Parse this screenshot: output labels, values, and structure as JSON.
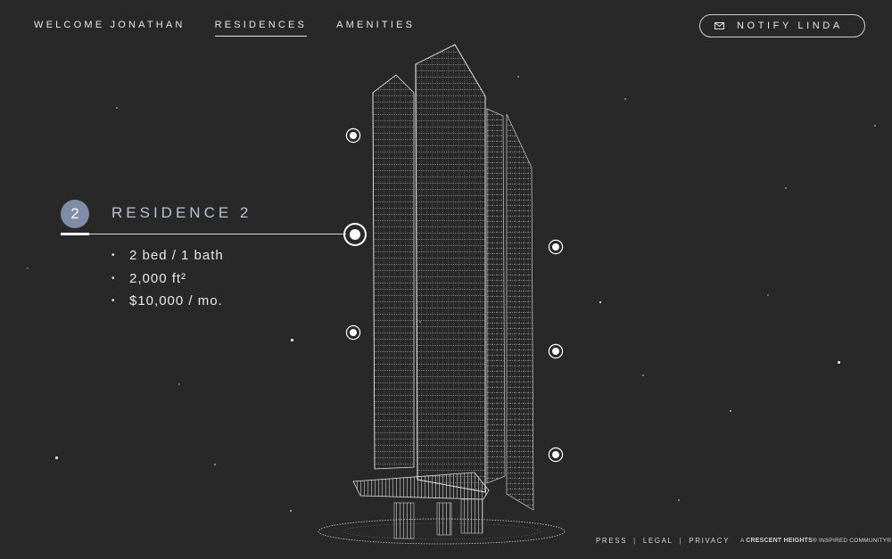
{
  "nav": {
    "items": [
      {
        "label": "WELCOME JONATHAN",
        "active": false
      },
      {
        "label": "RESIDENCES",
        "active": true
      },
      {
        "label": "AMENITIES",
        "active": false
      }
    ],
    "notify": {
      "label": "NOTIFY LINDA",
      "icon": "mail-icon"
    }
  },
  "residence": {
    "number": "2",
    "title": "RESIDENCE 2",
    "details": [
      "2 bed / 1 bath",
      "2,000 ft²",
      "$10,000 / mo."
    ],
    "badge_color": "#7d8da8"
  },
  "footer": {
    "links": [
      "PRESS",
      "LEGAL",
      "PRIVACY"
    ],
    "brand_prefix": "A",
    "brand_name": "CRESCENT HEIGHTS",
    "brand_suffix": "® INSPIRED COMMUNITY®"
  },
  "colors": {
    "background": "#282828",
    "accent": "#7d8da8",
    "line": "#ffffff"
  }
}
